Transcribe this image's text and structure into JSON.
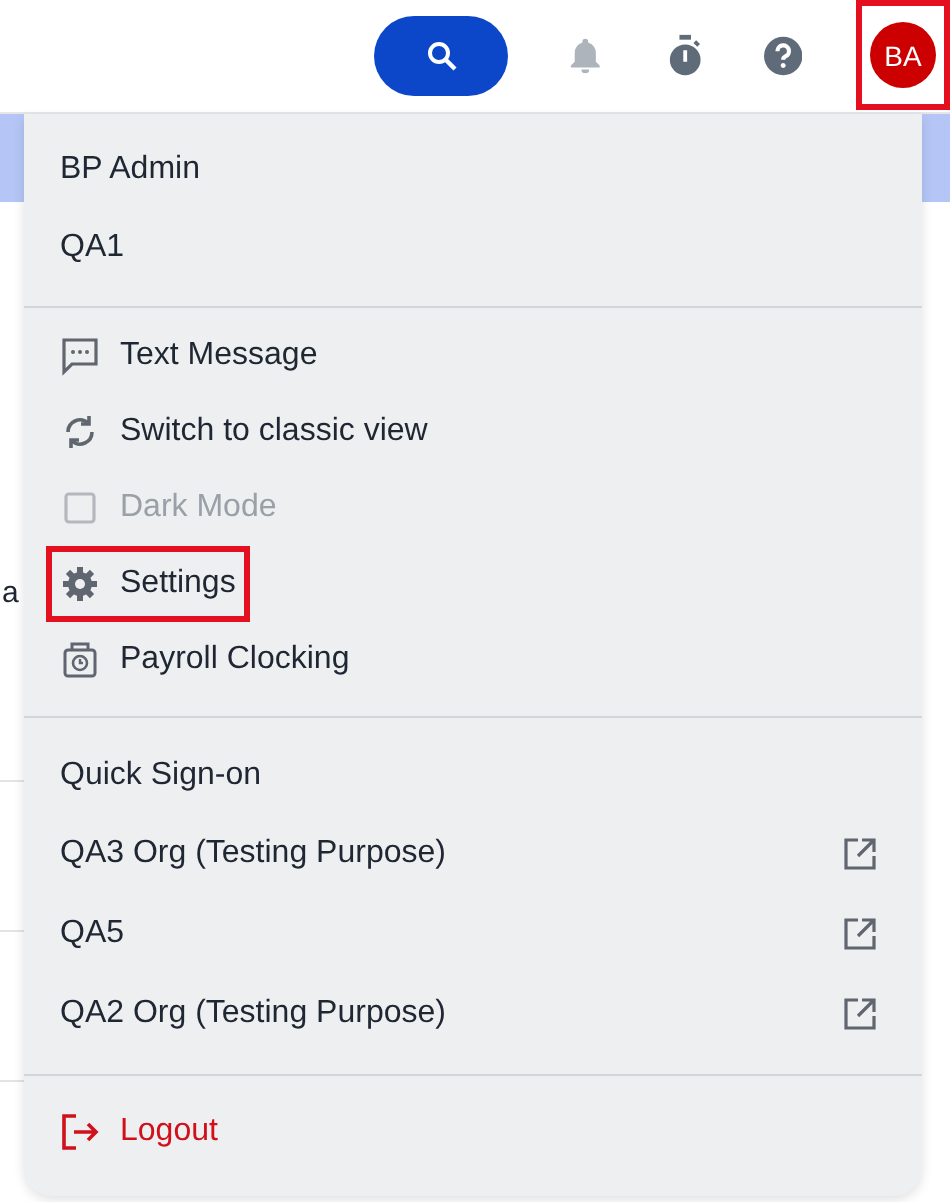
{
  "header": {
    "avatar": {
      "initials": "BA",
      "highlighted": true
    }
  },
  "background": {
    "text": "a"
  },
  "menu": {
    "user": [
      "BP Admin",
      "QA1"
    ],
    "items": [
      {
        "kind": "message",
        "label": "Text Message",
        "disabled": false,
        "highlighted": false
      },
      {
        "kind": "switch",
        "label": "Switch to classic view",
        "disabled": false,
        "highlighted": false
      },
      {
        "kind": "checkbox",
        "label": "Dark Mode",
        "disabled": true,
        "checked": false,
        "highlighted": false
      },
      {
        "kind": "settings",
        "label": "Settings",
        "disabled": false,
        "highlighted": true
      },
      {
        "kind": "clock",
        "label": "Payroll Clocking",
        "disabled": false,
        "highlighted": false
      }
    ],
    "quick_sign_on": {
      "title": "Quick Sign-on",
      "orgs": [
        "QA3 Org (Testing Purpose)",
        "QA5",
        "QA2 Org (Testing Purpose)"
      ]
    },
    "logout": "Logout"
  }
}
